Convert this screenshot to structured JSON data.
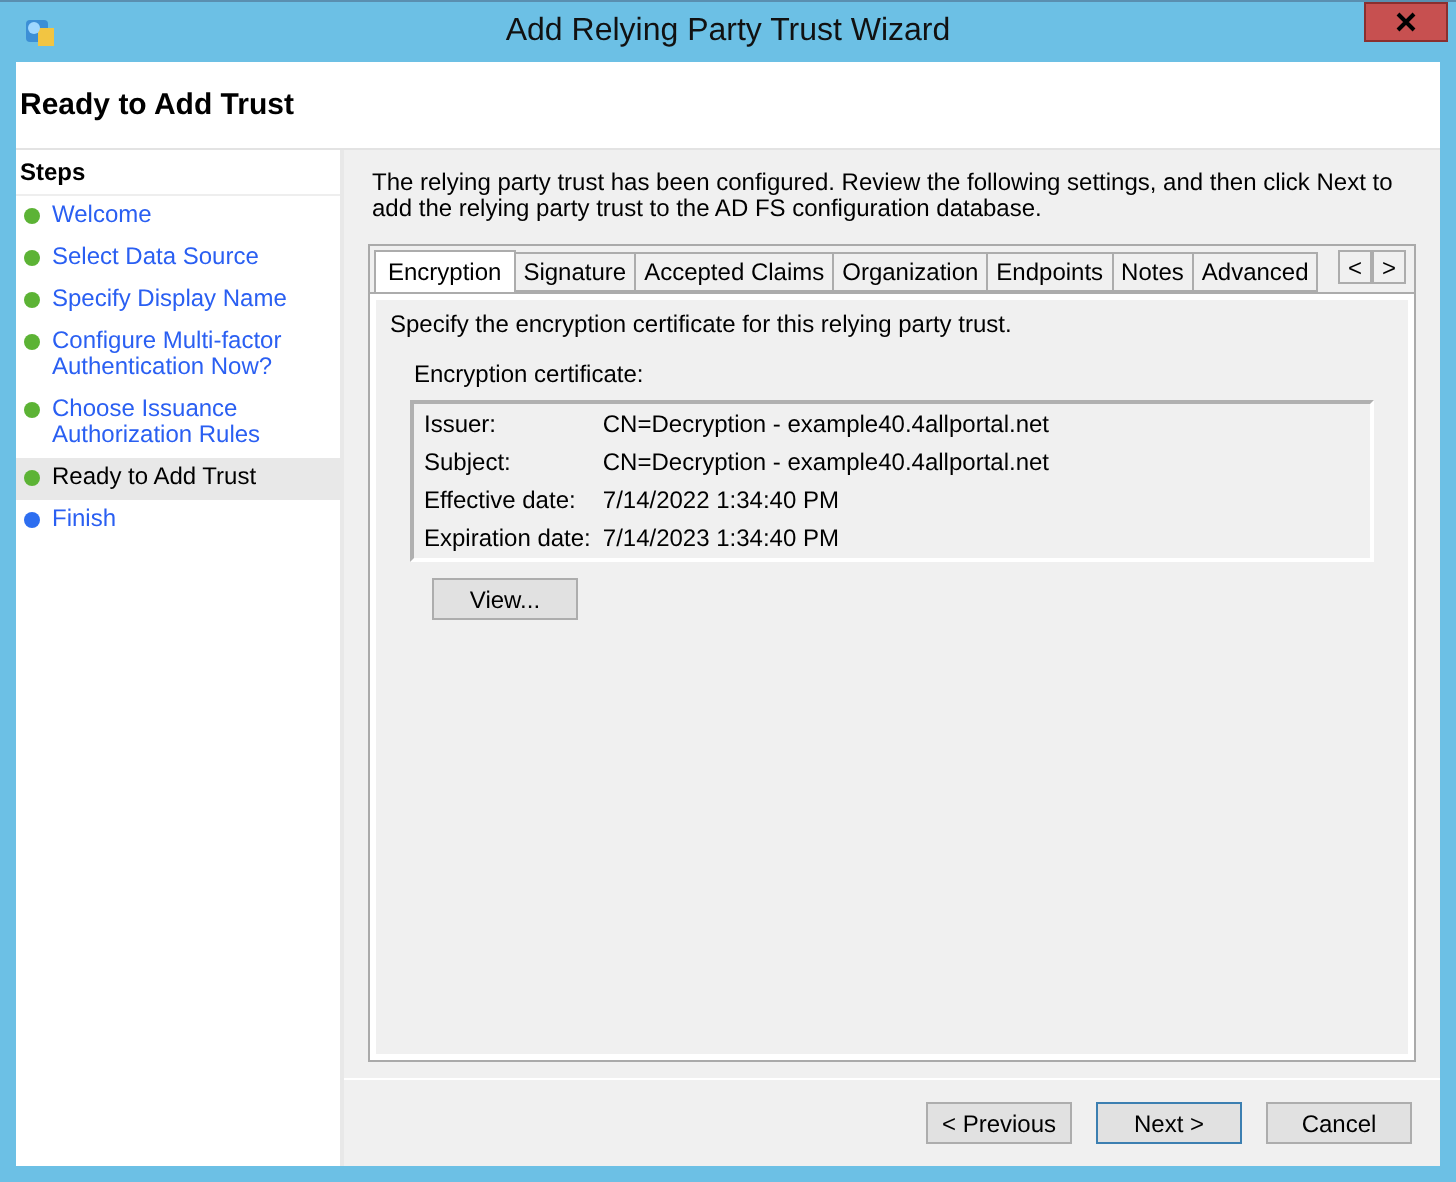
{
  "window": {
    "title": "Add Relying Party Trust Wizard"
  },
  "header": {
    "title": "Ready to Add Trust"
  },
  "steps": {
    "title": "Steps",
    "items": [
      {
        "label": "Welcome",
        "completed": true,
        "selected": false
      },
      {
        "label": "Select Data Source",
        "completed": true,
        "selected": false
      },
      {
        "label": "Specify Display Name",
        "completed": true,
        "selected": false
      },
      {
        "label": "Configure Multi-factor Authentication Now?",
        "completed": true,
        "selected": false
      },
      {
        "label": "Choose Issuance Authorization Rules",
        "completed": true,
        "selected": false
      },
      {
        "label": "Ready to Add Trust",
        "completed": true,
        "selected": true
      },
      {
        "label": "Finish",
        "completed": false,
        "selected": false
      }
    ]
  },
  "intro": "The relying party trust has been configured. Review the following settings, and then click Next to add the relying party trust to the AD FS configuration database.",
  "tabs": [
    {
      "label": "Encryption",
      "selected": true
    },
    {
      "label": "Signature",
      "selected": false
    },
    {
      "label": "Accepted Claims",
      "selected": false
    },
    {
      "label": "Organization",
      "selected": false
    },
    {
      "label": "Endpoints",
      "selected": false
    },
    {
      "label": "Notes",
      "selected": false
    },
    {
      "label": "Advanced",
      "selected": false
    }
  ],
  "tab_scroll": [
    "<",
    ">"
  ],
  "panel": {
    "description": "Specify the encryption certificate for this relying party trust.",
    "group_label": "Encryption certificate:",
    "fields": [
      {
        "label": "Issuer:",
        "value": "CN=Decryption - example40.4allportal.net"
      },
      {
        "label": "Subject:",
        "value": "CN=Decryption - example40.4allportal.net"
      },
      {
        "label": "Effective date:",
        "value": "7/14/2022 1:34:40 PM"
      },
      {
        "label": "Expiration date:",
        "value": "7/14/2023 1:34:40 PM"
      }
    ],
    "button": "View..."
  },
  "buttons": [
    {
      "label": "< Previous",
      "default": false
    },
    {
      "label": "Next >",
      "default": true
    },
    {
      "label": "Cancel",
      "default": false
    }
  ]
}
